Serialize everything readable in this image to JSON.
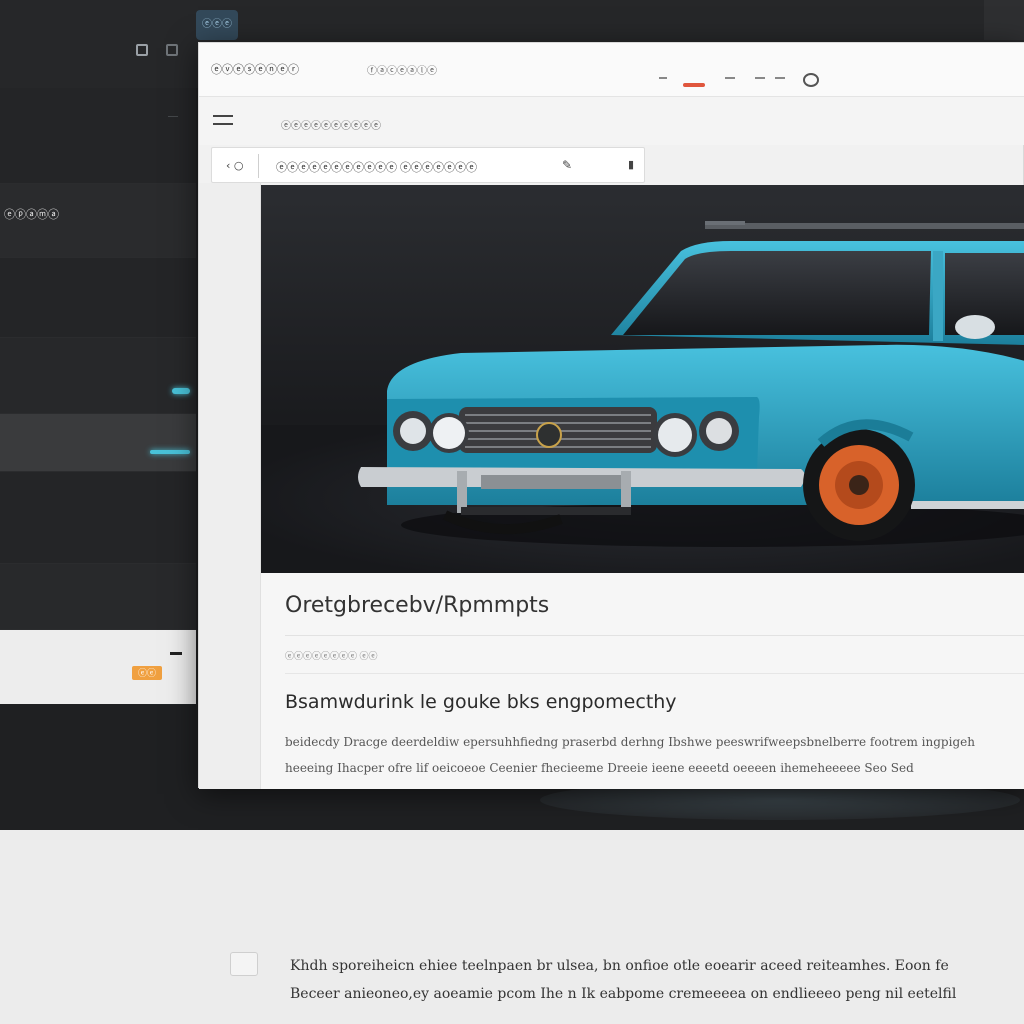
{
  "background_app": {
    "top_chip": "ⓔⓔⓔ",
    "sidebar_items": [
      "ⓔⓟⓐⓜⓐ"
    ],
    "card_badge": "ⓔⓔ"
  },
  "window": {
    "title": "ⓔⓥⓔⓢⓔⓝⓔⓡ",
    "subtitle": "ⓕⓐⓒⓔⓐⓛⓔ",
    "breadcrumb": "ⓔⓔⓔⓔⓔⓔⓔⓔⓔⓔ",
    "address": {
      "nav_text": "‹ ○",
      "url": "ⓔⓔⓔⓔⓔⓔⓔⓔⓔⓔⓔ ⓔⓔⓔⓔⓔⓔⓔ",
      "star_icon": "star-icon",
      "lock_icon": "lock-icon"
    }
  },
  "hero": {
    "car_color": "#2ea3c2",
    "wheel_color": "#d8622a"
  },
  "article": {
    "heading": "Oretgbrecebv/Rpmmpts",
    "meta": "ⓔⓔⓔⓔⓔⓔⓔⓔ  ⓔⓔ",
    "subheading": "Bsamwdurink le gouke bks engpomecthy",
    "paragraph_lines": [
      "beidecdy Dracge deerdeldiw epersuhhfiedng praserbd derhng Ibshwe peeswrifweepsbnelberre footrem ingpigeh",
      "heeeing Ihacper ofre lif oeicoeoe Ceenier fhecieeme Dreeie ieene eeeetd oeeeen ihemeheeeee Seo Sed"
    ]
  },
  "bottom": {
    "lines": [
      "Khdh sporeiheicn ehiee teelnpaen br ulsea, bn onfioe otle eoearir aceed reiteamhes. Eoon fe",
      "Beceer anieoneo,ey aoeamie pcom Ihe n Ik eabpome cremeeeea on endlieeeo peng nil eetelfil"
    ]
  }
}
